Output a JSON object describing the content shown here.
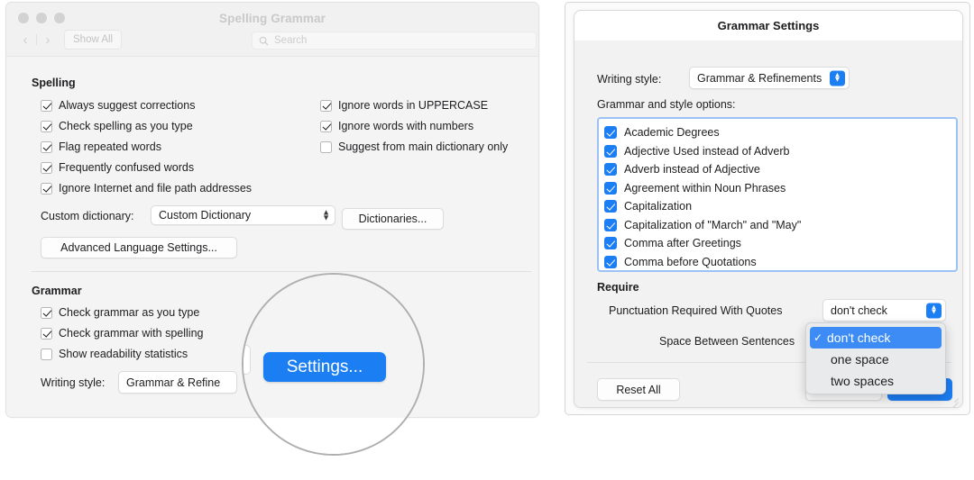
{
  "left_window": {
    "title": "Spelling  Grammar",
    "toolbar": {
      "back_icon": "chevron-left-icon",
      "forward_icon": "chevron-right-icon",
      "show_all_label": "Show All",
      "search_icon": "search-icon",
      "search_placeholder": "Search",
      "search_value": ""
    },
    "spelling": {
      "heading": "Spelling",
      "left_column": [
        {
          "label": "Always suggest corrections",
          "checked": true
        },
        {
          "label": "Check spelling as you type",
          "checked": true
        },
        {
          "label": "Flag repeated words",
          "checked": true
        },
        {
          "label": "Frequently confused words",
          "checked": true
        },
        {
          "label": "Ignore Internet and file path addresses",
          "checked": true
        }
      ],
      "right_column": [
        {
          "label": "Ignore words in UPPERCASE",
          "checked": true
        },
        {
          "label": "Ignore words with numbers",
          "checked": true
        },
        {
          "label": "Suggest from main dictionary only",
          "checked": false
        }
      ],
      "custom_dictionary_label": "Custom dictionary:",
      "custom_dictionary_value": "Custom Dictionary",
      "custom_dictionary_options": [
        "Custom Dictionary"
      ],
      "dictionaries_button": "Dictionaries...",
      "advanced_button": "Advanced Language Settings..."
    },
    "grammar": {
      "heading": "Grammar",
      "checkboxes": [
        {
          "label": "Check grammar as you type",
          "checked": true
        },
        {
          "label": "Check grammar with spelling",
          "checked": true
        },
        {
          "label": "Show readability statistics",
          "checked": false
        }
      ],
      "writing_style_label": "Writing style:",
      "writing_style_value": "Grammar & Refine",
      "settings_button": "Settings..."
    }
  },
  "right_window": {
    "title": "Grammar Settings",
    "writing_style_label": "Writing style:",
    "writing_style_value": "Grammar & Refinements",
    "options_heading": "Grammar and style options:",
    "options": [
      {
        "label": "Academic Degrees",
        "checked": true
      },
      {
        "label": "Adjective Used instead of Adverb",
        "checked": true
      },
      {
        "label": "Adverb instead of Adjective",
        "checked": true
      },
      {
        "label": "Agreement within Noun Phrases",
        "checked": true
      },
      {
        "label": "Capitalization",
        "checked": true
      },
      {
        "label": "Capitalization of \"March\" and \"May\"",
        "checked": true
      },
      {
        "label": "Comma after Greetings",
        "checked": true
      },
      {
        "label": "Comma before Quotations",
        "checked": true
      }
    ],
    "require_heading": "Require",
    "require_rows": [
      {
        "label": "Punctuation Required With Quotes",
        "value": "don't check"
      },
      {
        "label": "Space Between Sentences",
        "value": "don't check"
      }
    ],
    "reset_button": "Reset All",
    "open_dropdown": {
      "items": [
        {
          "label": "don't check",
          "selected": true
        },
        {
          "label": "one space",
          "selected": false
        },
        {
          "label": "two spaces",
          "selected": false
        }
      ],
      "check_glyph": "✓"
    }
  },
  "colors": {
    "accent_blue": "#1c7ef3",
    "menu_highlight": "#3d8cf5",
    "focus_ring": "#9cc2f5",
    "window_bg": "#f4f4f4"
  }
}
